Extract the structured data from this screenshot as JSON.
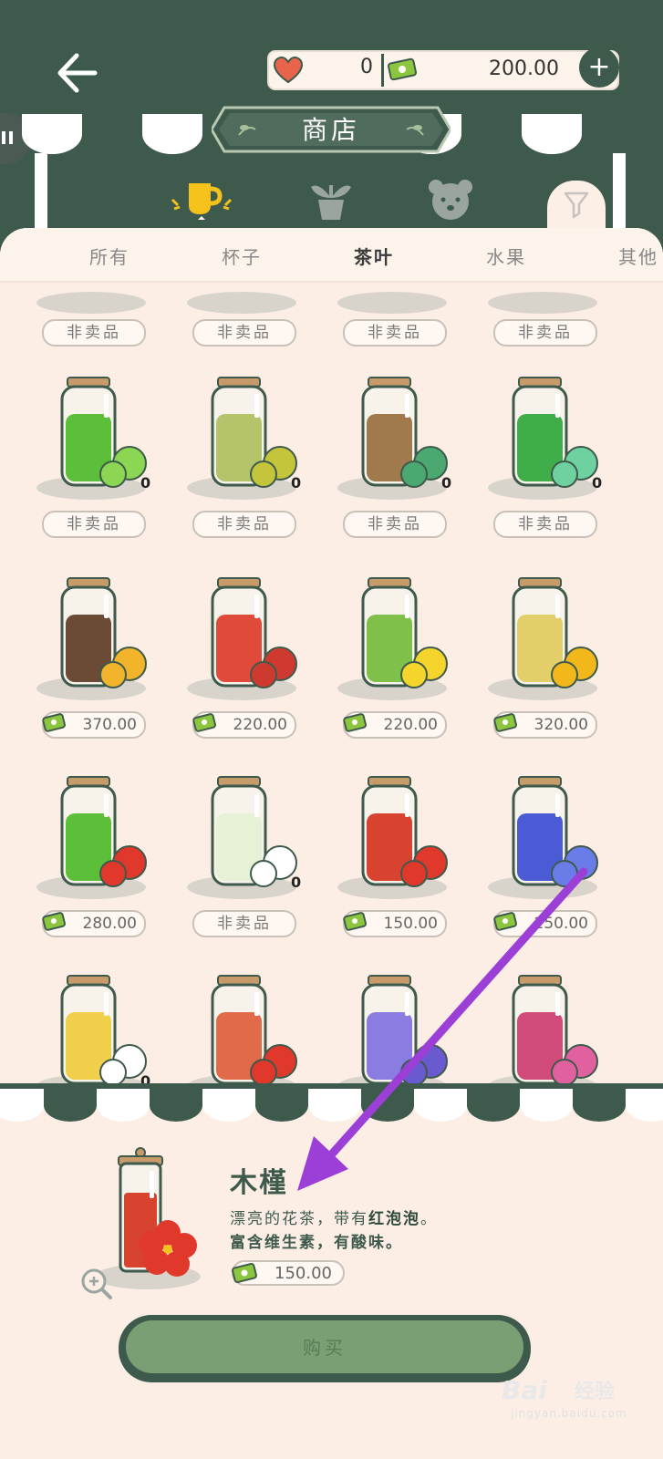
{
  "header": {
    "hearts": "0",
    "money": "200.00",
    "plus_label": "+",
    "title": "商店"
  },
  "categories": [
    {
      "icon": "cup-icon",
      "active": true
    },
    {
      "icon": "plant-icon",
      "active": false
    },
    {
      "icon": "bear-icon",
      "active": false
    }
  ],
  "tabs": [
    {
      "label": "所有",
      "active": false
    },
    {
      "label": "杯子",
      "active": false
    },
    {
      "label": "茶叶",
      "active": true
    },
    {
      "label": "水果",
      "active": false
    },
    {
      "label": "其他",
      "active": false
    }
  ],
  "rows": [
    [
      {
        "jar": "mint",
        "count": "0",
        "price": "非卖品",
        "sale": false
      },
      {
        "jar": "lemon-balm",
        "count": "0",
        "price": "非卖品",
        "sale": false
      },
      {
        "jar": "lemongrass-sack",
        "count": "0",
        "price": "非卖品",
        "sale": false
      },
      {
        "jar": "lemongrass-jar",
        "count": "0",
        "price": "非卖品",
        "sale": false
      }
    ],
    [
      {
        "jar": "black-tea",
        "count": "",
        "price": "370.00",
        "sale": true
      },
      {
        "jar": "strawberry",
        "count": "",
        "price": "220.00",
        "sale": true
      },
      {
        "jar": "lemon",
        "count": "",
        "price": "220.00",
        "sale": true
      },
      {
        "jar": "osmanthus",
        "count": "",
        "price": "320.00",
        "sale": true
      }
    ],
    [
      {
        "jar": "apple",
        "count": "",
        "price": "280.00",
        "sale": true
      },
      {
        "jar": "jasmine",
        "count": "0",
        "price": "非卖品",
        "sale": false
      },
      {
        "jar": "hibiscus",
        "count": "",
        "price": "150.00",
        "sale": true
      },
      {
        "jar": "butterfly-pea",
        "count": "",
        "price": "250.00",
        "sale": true
      }
    ],
    [
      {
        "jar": "chamomile",
        "count": "0",
        "price": "",
        "sale": false
      },
      {
        "jar": "rose",
        "count": "",
        "price": "",
        "sale": false
      },
      {
        "jar": "lavender",
        "count": "",
        "price": "",
        "sale": false
      },
      {
        "jar": "rose-pink",
        "count": "",
        "price": "",
        "sale": false
      }
    ]
  ],
  "top_partial_labels": [
    "非卖品",
    "非卖品",
    "非卖品",
    "非卖品"
  ],
  "detail": {
    "name": "木槿",
    "desc1_prefix": "漂亮的花茶，带有",
    "desc1_bold": "红泡泡",
    "desc1_suffix": "。",
    "desc2": "富含维生素，有酸味。",
    "price": "150.00",
    "buy_label": "购买"
  },
  "watermark": {
    "brand": "Bai",
    "brand2": "经验",
    "sub": "jingyan.baidu.com"
  },
  "colors": {
    "dark_green": "#3e5a4c",
    "cream": "#fdeee5",
    "accent_yellow": "#f5c21b",
    "arrow": "#9b3fd6"
  }
}
